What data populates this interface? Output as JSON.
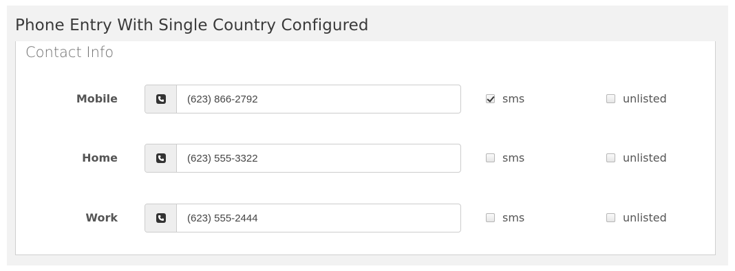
{
  "caption": "Phone Entry With Single Country Configured",
  "section": {
    "legend": "Contact Info"
  },
  "phones": [
    {
      "label": "Mobile",
      "value": "(623) 866-2792",
      "sms_label": "sms",
      "sms_checked": true,
      "unlisted_label": "unlisted",
      "unlisted_checked": false,
      "icon": "phone-icon"
    },
    {
      "label": "Home",
      "value": "(623) 555-3322",
      "sms_label": "sms",
      "sms_checked": false,
      "unlisted_label": "unlisted",
      "unlisted_checked": false,
      "icon": "phone-icon"
    },
    {
      "label": "Work",
      "value": "(623) 555-2444",
      "sms_label": "sms",
      "sms_checked": false,
      "unlisted_label": "unlisted",
      "unlisted_checked": false,
      "icon": "phone-icon"
    }
  ]
}
